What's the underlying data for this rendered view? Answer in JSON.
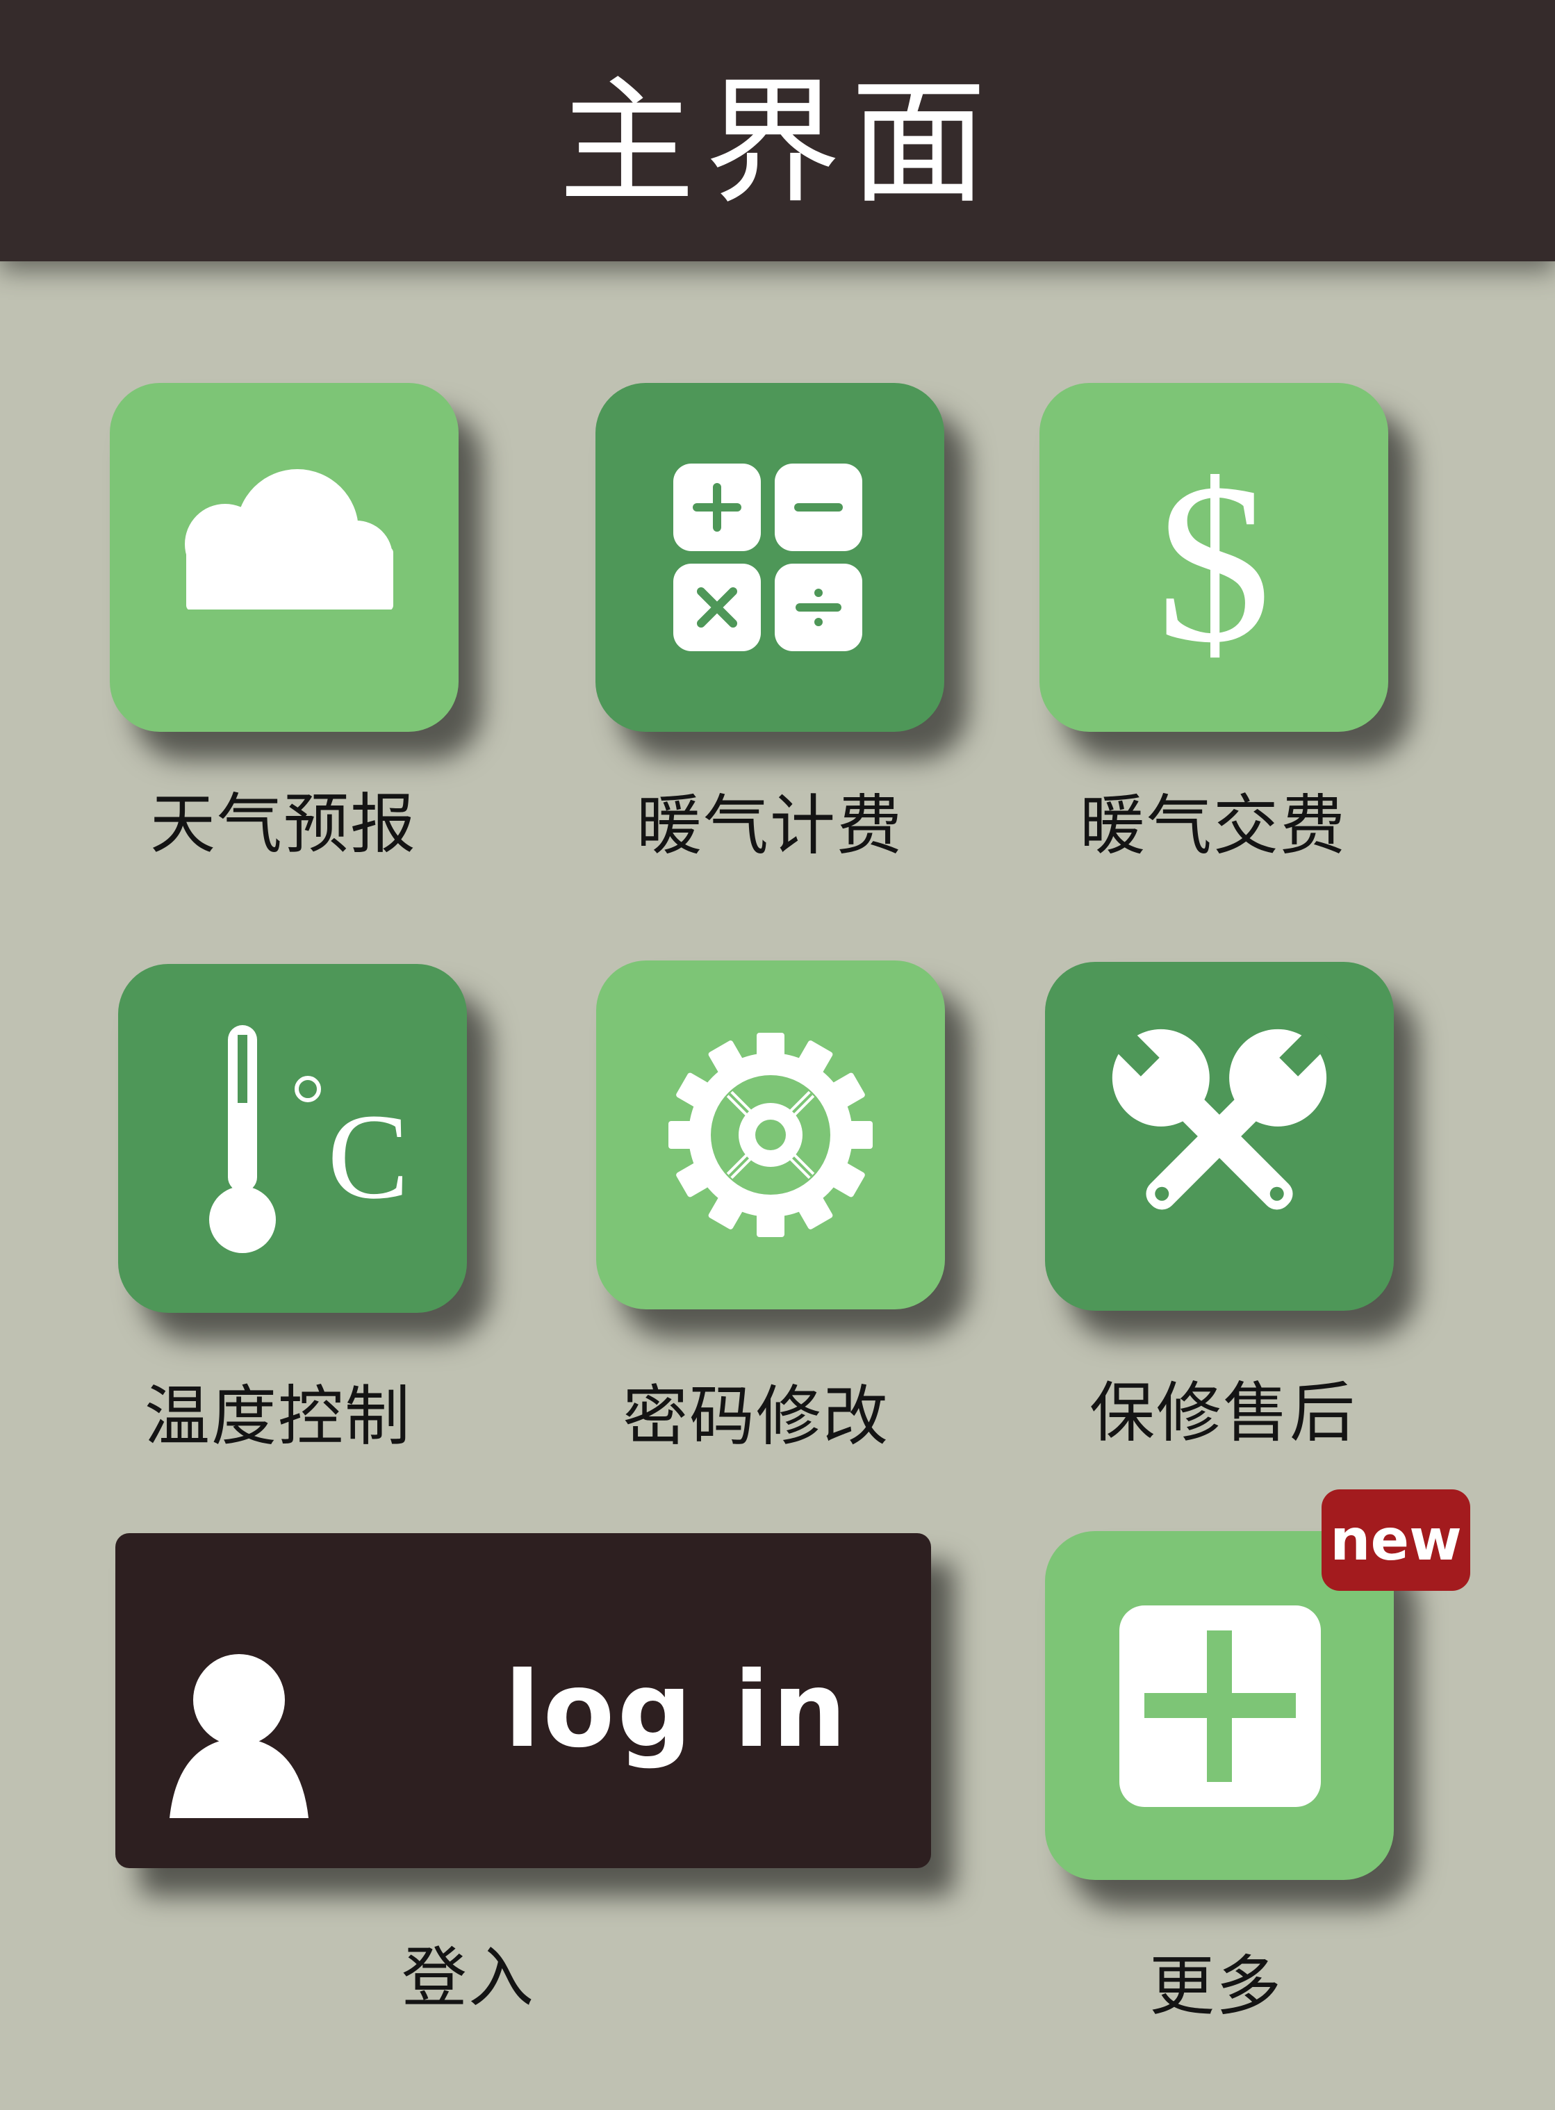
{
  "header": {
    "title": "主界面"
  },
  "tiles": [
    {
      "label": "天气预报",
      "icon": "cloud-icon",
      "tone": "light"
    },
    {
      "label": "暖气计费",
      "icon": "calculator-icon",
      "tone": "dark"
    },
    {
      "label": "暖气交费",
      "icon": "dollar-icon",
      "tone": "light"
    },
    {
      "label": "温度控制",
      "icon": "thermometer-icon",
      "tone": "dark"
    },
    {
      "label": "密码修改",
      "icon": "gear-icon",
      "tone": "light"
    },
    {
      "label": "保修售后",
      "icon": "wrench-icon",
      "tone": "dark"
    }
  ],
  "login": {
    "button_text": "log in",
    "label": "登入",
    "icon": "user-icon"
  },
  "more": {
    "label": "更多",
    "badge": "new",
    "icon": "plus-icon"
  },
  "glyphs": {
    "dollar": "$",
    "degree_c": "C"
  },
  "colors": {
    "background": "#bfc1b2",
    "header": "#352b2b",
    "tile_light": "#7dc576",
    "tile_dark": "#4e9758",
    "login_button": "#2d1f20",
    "badge": "#a31b1e"
  }
}
